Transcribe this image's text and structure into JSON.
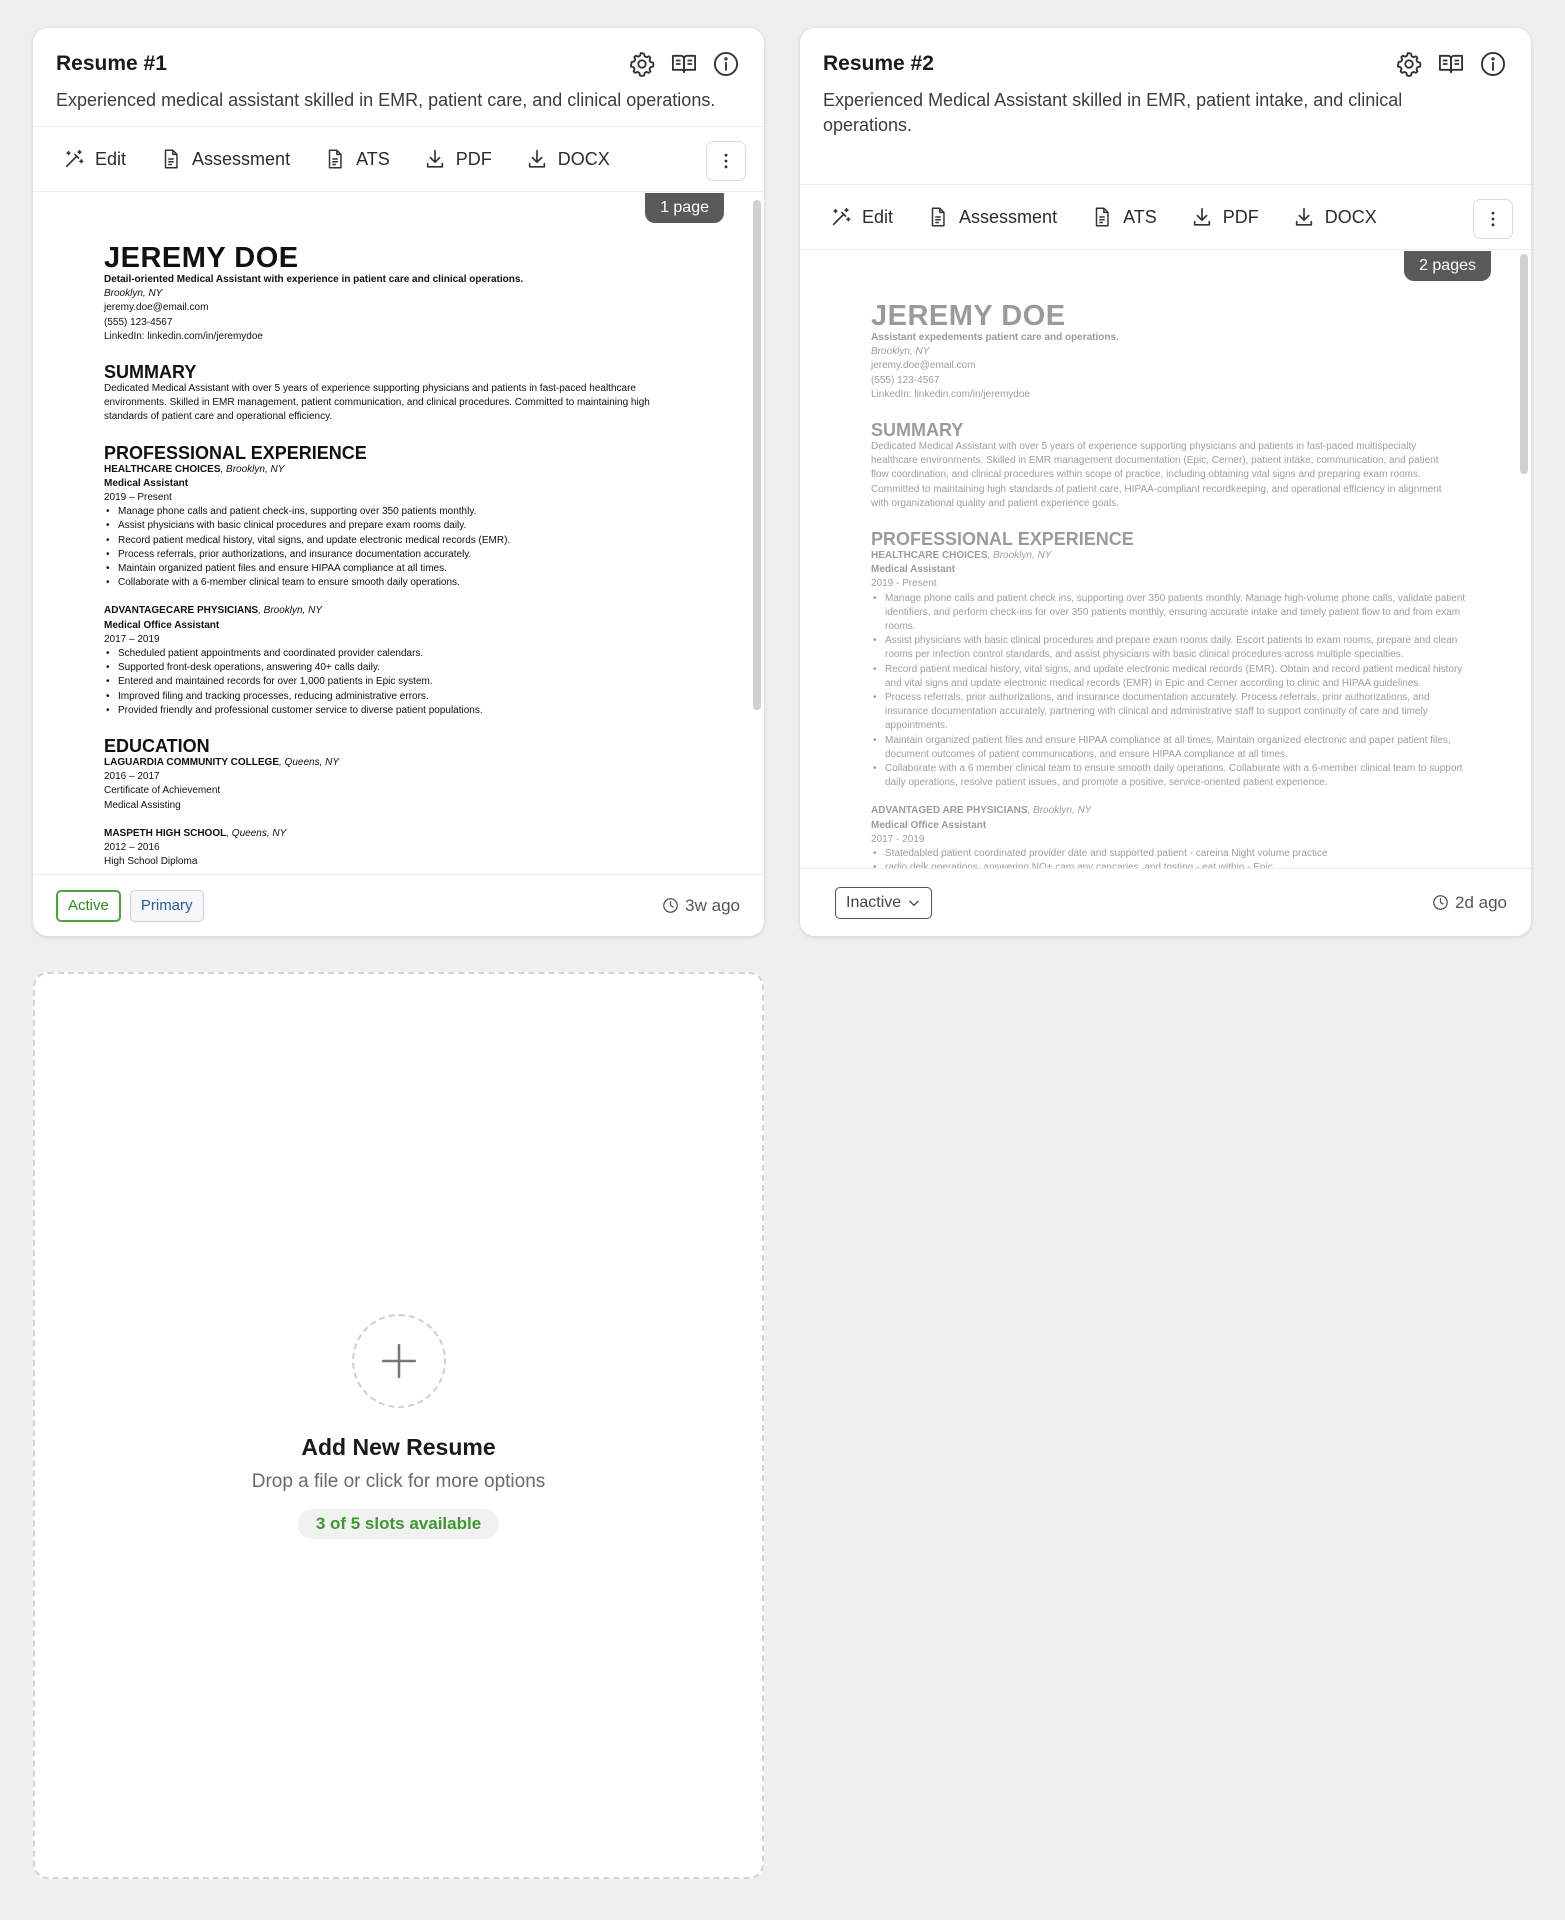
{
  "resumes": [
    {
      "title": "Resume #1",
      "description": "Experienced medical assistant skilled in EMR, patient care, and clinical operations.",
      "toolbar": {
        "edit": "Edit",
        "assessment": "Assessment",
        "ats": "ATS",
        "pdf": "PDF",
        "docx": "DOCX"
      },
      "pages_badge": "1 page",
      "status": "Active",
      "role_badge": "Primary",
      "time_ago": "3w ago",
      "doc": {
        "name": "JEREMY DOE",
        "tagline": "Detail-oriented Medical Assistant with experience in patient care and clinical operations.",
        "location": "Brooklyn, NY",
        "email": "jeremy.doe@email.com",
        "phone": "(555) 123-4567",
        "linkedin": "LinkedIn: linkedin.com/in/jeremydoe",
        "summary_heading": "SUMMARY",
        "summary": "Dedicated Medical Assistant with over 5 years of experience supporting physicians and patients in fast-paced healthcare environments. Skilled in EMR management, patient communication, and clinical procedures. Committed to maintaining high standards of patient care and operational efficiency.",
        "experience_heading": "PROFESSIONAL EXPERIENCE",
        "jobs": [
          {
            "org": "HEALTHCARE CHOICES",
            "loc": ", Brooklyn, NY",
            "role": "Medical Assistant",
            "dates": "2019 – Present",
            "bullets": [
              "Manage phone calls and patient check-ins, supporting over 350 patients monthly.",
              "Assist physicians with basic clinical procedures and prepare exam rooms daily.",
              "Record patient medical history, vital signs, and update electronic medical records (EMR).",
              "Process referrals, prior authorizations, and insurance documentation accurately.",
              "Maintain organized patient files and ensure HIPAA compliance at all times.",
              "Collaborate with a 6-member clinical team to ensure smooth daily operations."
            ]
          },
          {
            "org": "ADVANTAGECARE PHYSICIANS",
            "loc": ", Brooklyn, NY",
            "role": "Medical Office Assistant",
            "dates": "2017 – 2019",
            "bullets": [
              "Scheduled patient appointments and coordinated provider calendars.",
              "Supported front-desk operations, answering 40+ calls daily.",
              "Entered and maintained records for over 1,000 patients in Epic system.",
              "Improved filing and tracking processes, reducing administrative errors.",
              "Provided friendly and professional customer service to diverse patient populations."
            ]
          }
        ],
        "education_heading": "EDUCATION",
        "schools": [
          {
            "org": "LAGUARDIA COMMUNITY COLLEGE",
            "loc": ", Queens, NY",
            "lines": [
              "2016 – 2017",
              "Certificate of Achievement",
              "Medical Assisting"
            ]
          },
          {
            "org": "MASPETH HIGH SCHOOL",
            "loc": ", Queens, NY",
            "lines": [
              "2012 – 2016",
              "High School Diploma"
            ]
          }
        ]
      }
    },
    {
      "title": "Resume #2",
      "description": "Experienced Medical Assistant skilled in EMR, patient intake, and clinical operations.",
      "toolbar": {
        "edit": "Edit",
        "assessment": "Assessment",
        "ats": "ATS",
        "pdf": "PDF",
        "docx": "DOCX"
      },
      "pages_badge": "2 pages",
      "status": "Inactive",
      "time_ago": "2d ago",
      "doc": {
        "name": "JEREMY DOE",
        "tagline": "Assistant expedements patient care and operations.",
        "location": "Brooklyn, NY",
        "email": "jeremy.doe@email.com",
        "phone": "(555) 123-4567",
        "linkedin": "LinkedIn: linkedin.com/in/jeremydoe",
        "summary_heading": "SUMMARY",
        "summary": "Dedicated Medical Assistant with over 5 years of experience supporting physicians and patients in fast-paced multispecialty healthcare environments. Skilled in EMR management documentation (Epic, Cerner), patient intake, communication, and patient flow coordination, and clinical procedures within scope of practice, including obtaining vital signs and preparing exam rooms. Committed to maintaining high standards of patient care, HIPAA-compliant recordkeeping, and operational efficiency in alignment with organizational quality and patient experience goals.",
        "experience_heading": "PROFESSIONAL EXPERIENCE",
        "jobs": [
          {
            "org": "HEALTHCARE CHOICES",
            "loc": ", Brooklyn, NY",
            "role": "Medical Assistant",
            "dates": "2019 - Present",
            "bullets": [
              "Manage phone calls and patient check ins, supporting over 350 patients monthly. Manage high-volume phone calls, validate patient identifiers, and perform check-ins for over 350 patients monthly, ensuring accurate intake and timely patient flow to and from exam rooms.",
              "Assist physicians with basic clinical procedures and prepare exam rooms daily. Escort patients to exam rooms, prepare and clean rooms per infection control standards, and assist physicians with basic clinical procedures across multiple specialties.",
              "Record patient medical history, vital signs, and update electronic medical records (EMR). Obtain and record patient medical history and vital signs and update electronic medical records (EMR) in Epic and Cerner according to clinic and HIPAA guidelines.",
              "Process referrals, prior authorizations, and insurance documentation accurately. Process referrals, prior authorizations, and insurance documentation accurately, partnering with clinical and administrative staff to support continuity of care and timely appointments.",
              "Maintain organized patient files and ensure HIPAA compliance at all times. Maintain organized electronic and paper patient files, document outcomes of patient communications, and ensure HIPAA compliance at all times.",
              "Collaborate with a 6 member clinical team to ensure smooth daily operations. Collaborate with a 6-member clinical team to support daily operations, resolve patient issues, and promote a positive, service-oriented patient experience."
            ]
          },
          {
            "org": "ADVANTAGED ARE PHYSICIANS",
            "loc": ", Brooklyn, NY",
            "role": "Medical Office Assistant",
            "dates": "2017 - 2019",
            "bullets": [
              "Statedabled patient coordinated provider date and supported patient - careina Night volume practice",
              "radio delk operations, answering NO+ cam any cancaries, and tosting - eat within - Epic"
            ]
          }
        ],
        "education_heading": "",
        "schools": []
      }
    }
  ],
  "add_card": {
    "title": "Add New Resume",
    "subtitle": "Drop a file or click for more options",
    "slots": "3 of 5 slots available"
  },
  "icons": [
    "gear-icon",
    "book-icon",
    "info-icon",
    "magic-wand-icon",
    "document-icon",
    "download-icon",
    "more-vertical-icon",
    "clock-icon",
    "chevron-down-icon",
    "plus-icon"
  ],
  "colors": {
    "active_green": "#2f8a25",
    "primary_blue": "#2b5aa0",
    "page_badge": "#5a5a5a",
    "background": "#efefef"
  }
}
